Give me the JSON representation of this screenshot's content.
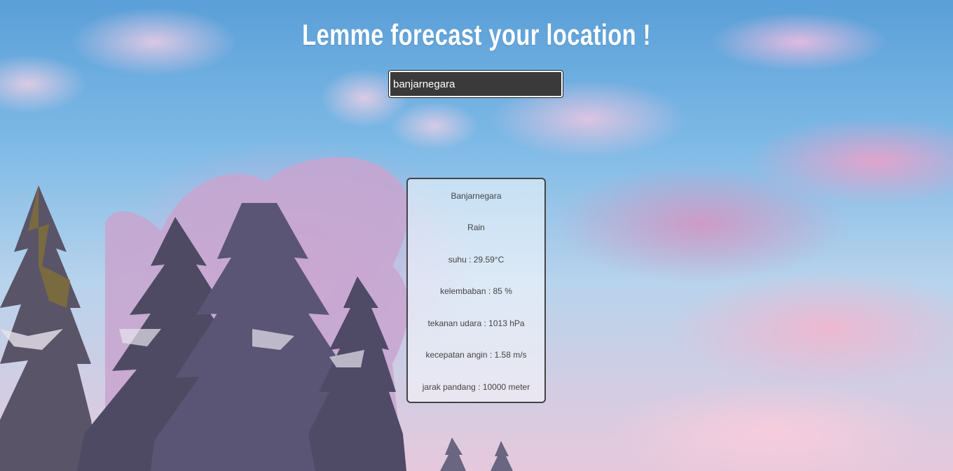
{
  "header": {
    "title": "Lemme forecast your location !"
  },
  "search": {
    "value": "banjarnegara"
  },
  "weather": {
    "city": "Banjarnegara",
    "condition": "Rain",
    "temperature": "suhu : 29.59°C",
    "humidity": "kelembaban : 85 %",
    "pressure": "tekanan udara : 1013 hPa",
    "wind_speed": "kecepatan angin : 1.58 m/s",
    "visibility": "jarak pandang : 10000 meter"
  },
  "colors": {
    "title_text": "#ffffff",
    "input_background": "#3a3a3a",
    "card_border": "#444444"
  }
}
